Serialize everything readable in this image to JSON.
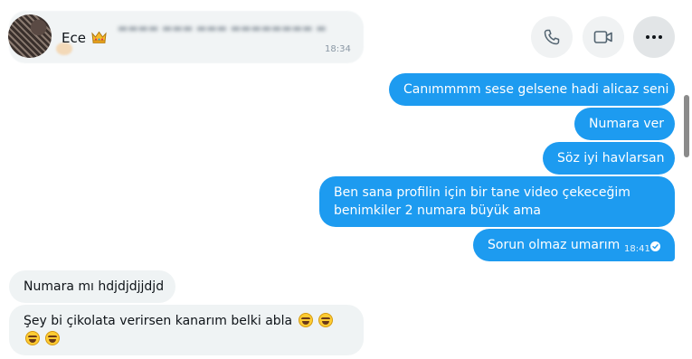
{
  "header": {
    "contact_name": "Ece",
    "contact_badge": "crown-emoji",
    "buttons": [
      "phone-icon",
      "video-camera-icon",
      "more-icon"
    ]
  },
  "faded_message": {
    "time": "18:34"
  },
  "messages": [
    {
      "direction": "out",
      "text": "Canımmmm sese gelsene hadi alicaz seni"
    },
    {
      "direction": "out",
      "text": "Numara ver"
    },
    {
      "direction": "out",
      "text": "Söz iyi havlarsan"
    },
    {
      "direction": "out",
      "text": "Ben sana profilin için bir tane video çekeceğim benimkiler 2 numara büyük ama"
    },
    {
      "direction": "out",
      "text": "Sorun olmaz umarım",
      "time": "18:41",
      "status": "sent-check-icon"
    },
    {
      "direction": "in",
      "text": "Numara mı hdjdjdjjdjd"
    },
    {
      "direction": "in",
      "text": "Şey bi çikolata verirsen kanarım belki abla",
      "emoji_count": 4
    }
  ],
  "colors": {
    "outgoing_bubble": "#1d9bf0",
    "incoming_bubble": "#eff3f4",
    "header_button": "#f0f2f3"
  }
}
